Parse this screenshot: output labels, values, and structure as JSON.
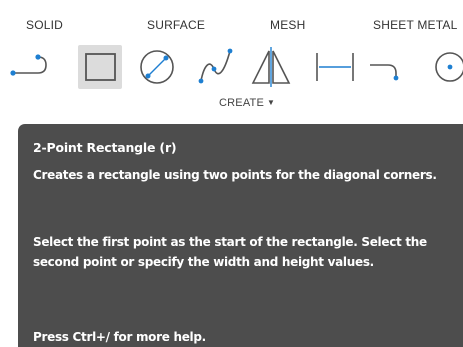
{
  "tabs": [
    "SOLID",
    "SURFACE",
    "MESH",
    "SHEET METAL"
  ],
  "tools": [
    {
      "icon": "fillet-curve-icon"
    },
    {
      "icon": "rectangle-icon",
      "active": true
    },
    {
      "icon": "circle-diameter-icon"
    },
    {
      "icon": "spline-icon"
    },
    {
      "icon": "mirror-icon"
    },
    {
      "icon": "dimension-icon"
    },
    {
      "icon": "arc-icon"
    },
    {
      "icon": "point-circle-icon"
    }
  ],
  "panel": {
    "label": "CREATE",
    "dropdown_icon": "dropdown-arrow-icon"
  },
  "tooltip": {
    "title": "2-Point Rectangle (r)",
    "description": "Creates a rectangle using two points for the diagonal corners.",
    "instructions": "Select the first point as the start of the rectangle. Select the second point or specify the width and height values.",
    "help": "Press Ctrl+/ for more help."
  },
  "colors": {
    "accent": "#1e7fd1",
    "icon_stroke": "#555555",
    "tooltip_bg": "#4d4d4d",
    "active_bg": "#dcdcdc"
  }
}
